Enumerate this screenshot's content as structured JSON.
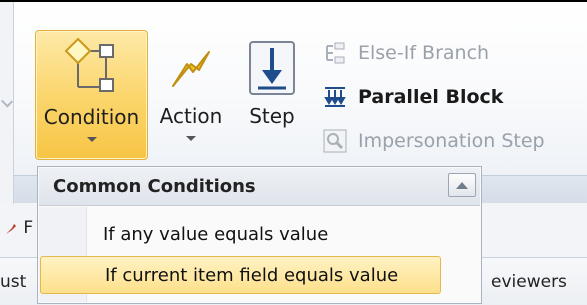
{
  "ribbon": {
    "buttons": {
      "condition_label": "Condition",
      "action_label": "Action",
      "step_label": "Step"
    },
    "small_buttons": {
      "else_if": "Else-If Branch",
      "parallel_block": "Parallel Block",
      "impersonation": "Impersonation Step"
    }
  },
  "dropdown": {
    "header": "Common Conditions",
    "items": [
      "If any value equals value",
      "If current item field equals value"
    ],
    "highlighted_index": 1
  },
  "background": {
    "left_partial_top": "F",
    "left_partial_bottom": "ust",
    "right_partial": "eviewers"
  },
  "icons": {
    "condition": "flowchart-diamond-icon",
    "action": "lightning-icon",
    "step": "down-arrow-step-icon",
    "else_if": "branch-icon",
    "parallel": "parallel-arrows-icon",
    "impersonation": "magnifier-icon",
    "scroll": "scroll-up-icon",
    "partial_left": "red-tool-icon"
  }
}
